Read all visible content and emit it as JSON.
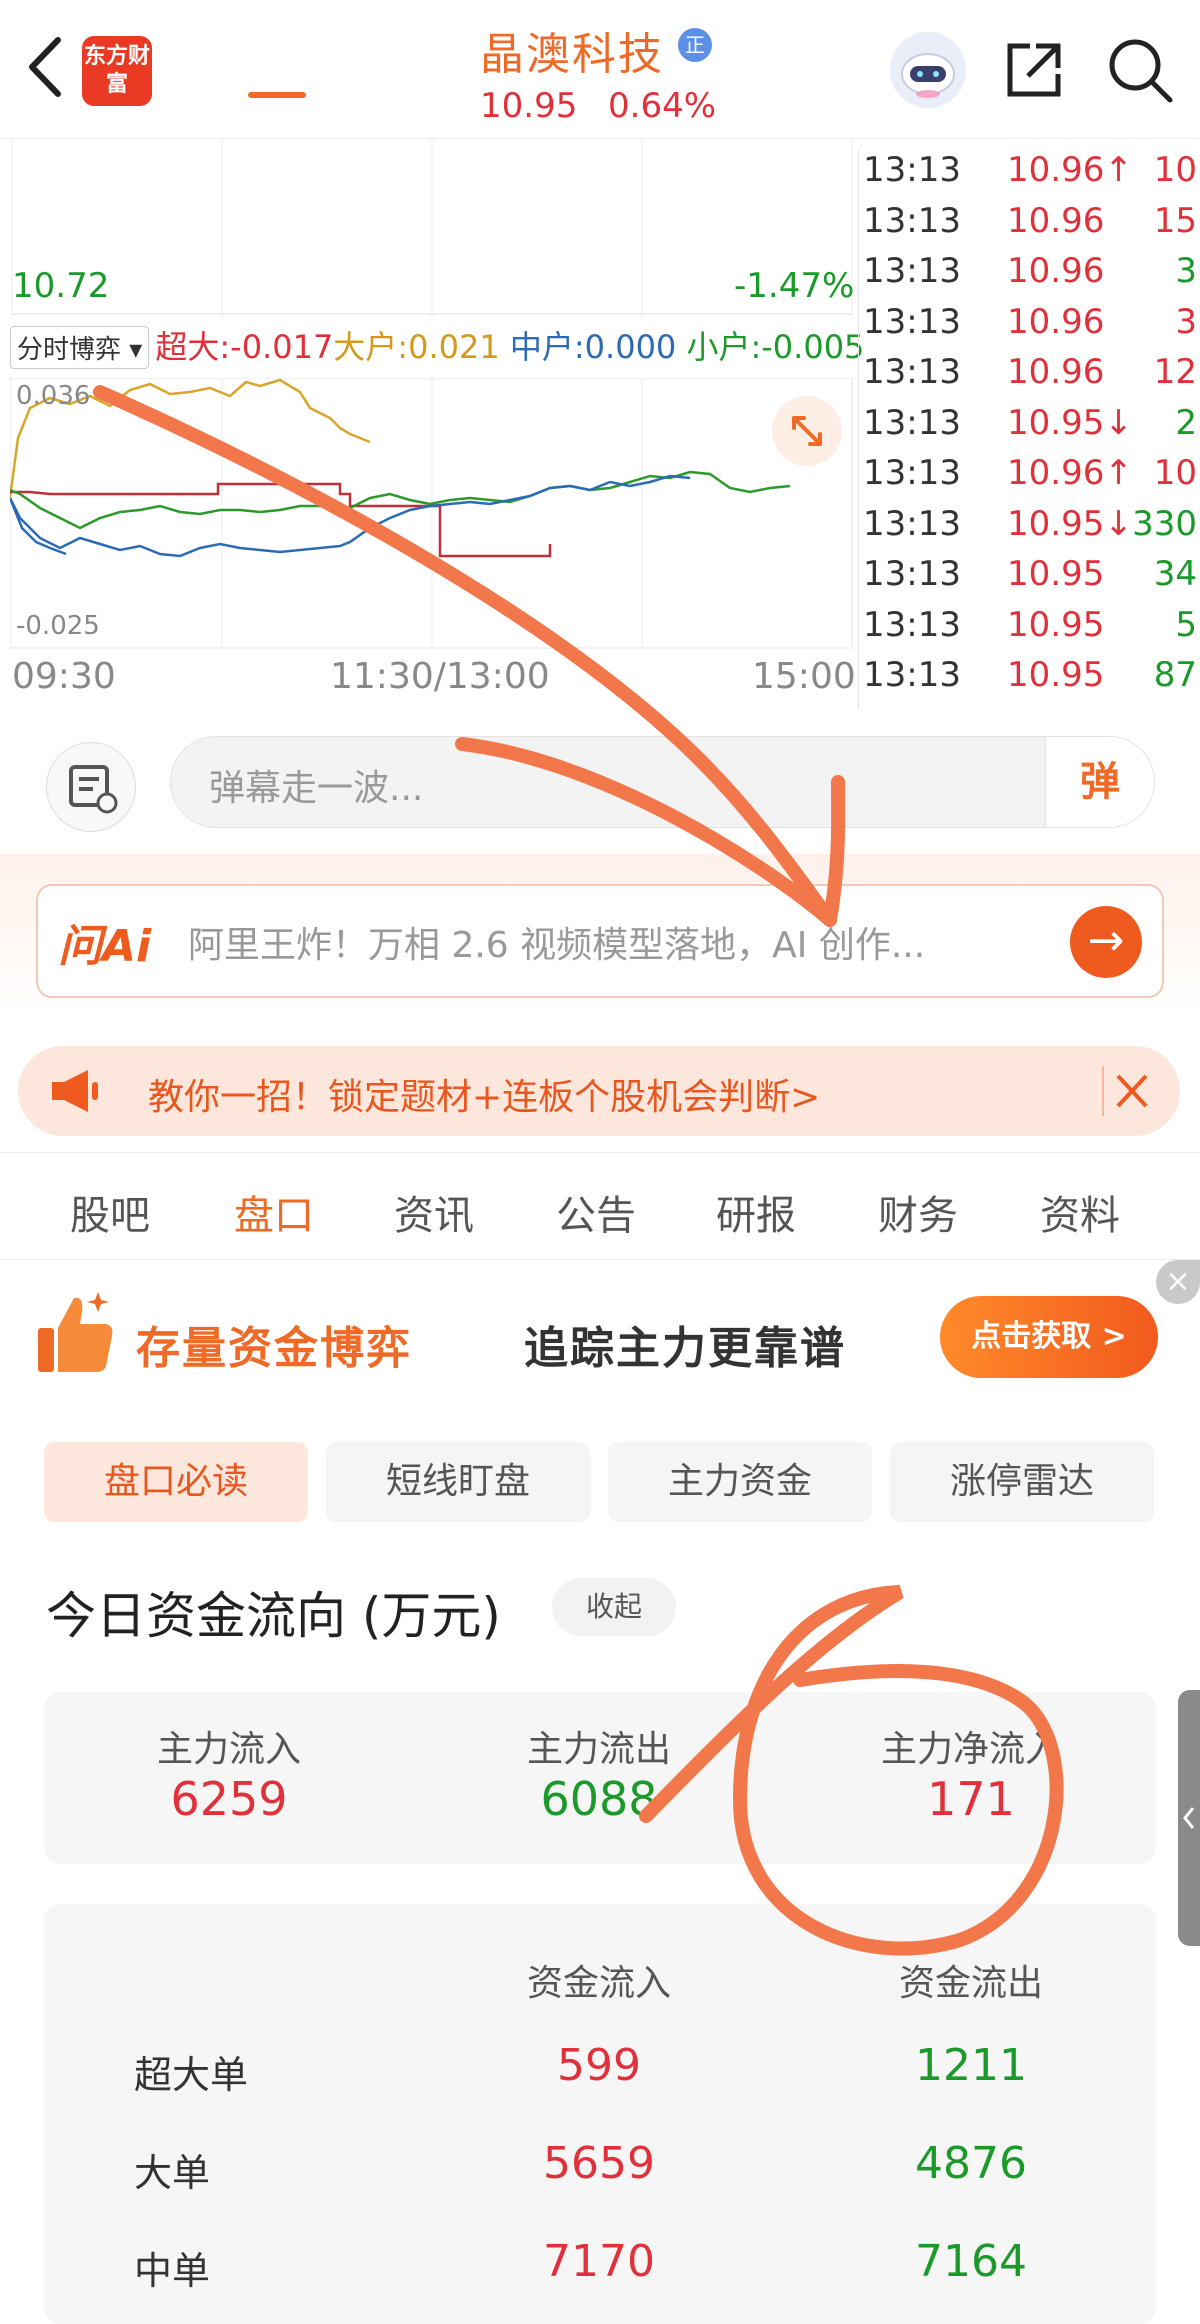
{
  "header": {
    "logo_text": "东方财富",
    "stock_name": "晶澳科技",
    "badge": "正",
    "price": "10.95",
    "change_pct": "0.64%"
  },
  "chart": {
    "low_price": "10.72",
    "low_pct": "-1.47%",
    "flow_selector": "分时博弈",
    "flow_items": [
      {
        "label": "超大:",
        "value": "-0.017",
        "color": "#e0303a"
      },
      {
        "label": "大户:",
        "value": "0.021",
        "color": "#d59a1c"
      },
      {
        "label": "中户:",
        "value": "0.000",
        "color": "#2b6bb5"
      },
      {
        "label": "小户:",
        "value": "-0.005",
        "color": "#1b9a2a"
      }
    ],
    "y_max": "0.036",
    "y_min": "-0.025",
    "time_axis": [
      "09:30",
      "11:30/13:00",
      "15:00"
    ]
  },
  "ticks": [
    {
      "time": "13:13",
      "price": "10.96↑",
      "vol": "10",
      "vcolor": "red"
    },
    {
      "time": "13:13",
      "price": "10.96",
      "vol": "15",
      "vcolor": "red"
    },
    {
      "time": "13:13",
      "price": "10.96",
      "vol": "3",
      "vcolor": "green"
    },
    {
      "time": "13:13",
      "price": "10.96",
      "vol": "3",
      "vcolor": "red"
    },
    {
      "time": "13:13",
      "price": "10.96",
      "vol": "12",
      "vcolor": "red"
    },
    {
      "time": "13:13",
      "price": "10.95↓",
      "vol": "2",
      "vcolor": "green"
    },
    {
      "time": "13:13",
      "price": "10.96↑",
      "vol": "10",
      "vcolor": "red"
    },
    {
      "time": "13:13",
      "price": "10.95↓",
      "vol": "330",
      "vcolor": "green"
    },
    {
      "time": "13:13",
      "price": "10.95",
      "vol": "34",
      "vcolor": "green"
    },
    {
      "time": "13:13",
      "price": "10.95",
      "vol": "5",
      "vcolor": "green"
    },
    {
      "time": "13:13",
      "price": "10.95",
      "vol": "87",
      "vcolor": "green"
    }
  ],
  "danmaku": {
    "placeholder": "弹幕走一波...",
    "button": "弹"
  },
  "ask_ai": {
    "logo": "问Ai",
    "text": "阿里王炸！万相 2.6 视频模型落地，AI 创作...",
    "go": "→"
  },
  "promo": {
    "text": "教你一招！锁定题材+连板个股机会判断>"
  },
  "tabs": [
    "股吧",
    "盘口",
    "资讯",
    "公告",
    "研报",
    "财务",
    "资料"
  ],
  "active_tab": "盘口",
  "ad": {
    "title": "存量资金博弈",
    "subtitle": "追踪主力更靠谱",
    "button": "点击获取 >",
    "close": "×"
  },
  "sub_tabs": [
    "盘口必读",
    "短线盯盘",
    "主力资金",
    "涨停雷达"
  ],
  "fund_flow": {
    "title": "今日资金流向 (万元)",
    "collapse": "收起",
    "summary": [
      {
        "label": "主力流入",
        "value": "6259"
      },
      {
        "label": "主力流出",
        "value": "6088"
      },
      {
        "label": "主力净流入",
        "value": "171"
      }
    ],
    "columns": [
      "资金流入",
      "资金流出"
    ],
    "rows": [
      {
        "label": "超大单",
        "inflow": "599",
        "outflow": "1211"
      },
      {
        "label": "大单",
        "inflow": "5659",
        "outflow": "4876"
      },
      {
        "label": "中单",
        "inflow": "7170",
        "outflow": "7164"
      }
    ]
  },
  "colors": {
    "accent": "#ef6a26",
    "up": "#e0303a",
    "down": "#1b9a2a",
    "annotation": "#f2774a"
  }
}
